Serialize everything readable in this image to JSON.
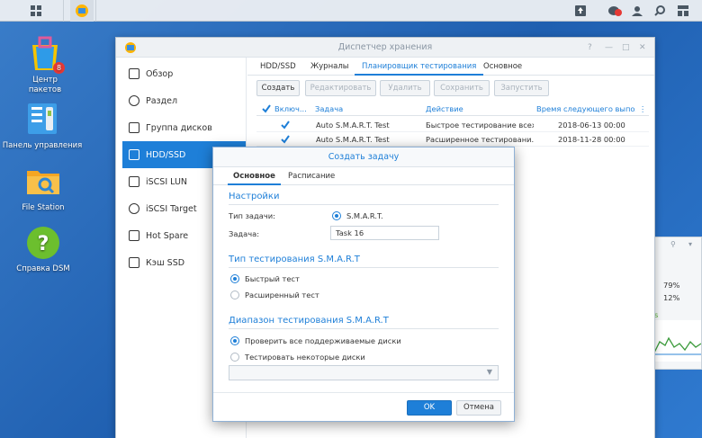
{
  "desktop": {
    "icons": [
      {
        "label_line1": "Центр",
        "label_line2": "пакетов",
        "badge": "8"
      },
      {
        "label": "Панель управления"
      },
      {
        "label": "File Station"
      },
      {
        "label": "Справка DSM"
      }
    ]
  },
  "widget": {
    "val1": "79%",
    "val2": "12%",
    "letter": "s"
  },
  "window": {
    "title": "Диспетчер хранения",
    "sidebar": [
      {
        "label": "Обзор"
      },
      {
        "label": "Раздел"
      },
      {
        "label": "Группа дисков"
      },
      {
        "label": "HDD/SSD"
      },
      {
        "label": "iSCSI LUN"
      },
      {
        "label": "iSCSI Target"
      },
      {
        "label": "Hot Spare"
      },
      {
        "label": "Кэш SSD"
      }
    ],
    "tabs": [
      "HDD/SSD",
      "Журналы",
      "Планировщик тестирования",
      "Основное"
    ],
    "toolbar": [
      "Создать",
      "Редактировать",
      "Удалить",
      "Сохранить",
      "Запустить"
    ],
    "columns": [
      "Включ...",
      "Задача",
      "Действие",
      "Время следующего выпол..."
    ],
    "rows": [
      {
        "task": "Auto S.M.A.R.T. Test",
        "action": "Быстрое тестирование всех...",
        "time": "2018-06-13 00:00"
      },
      {
        "task": "Auto S.M.A.R.T. Test",
        "action": "Расширенное тестировани...",
        "time": "2018-11-28 00:00"
      }
    ]
  },
  "dialog": {
    "title": "Создать задачу",
    "tabs": [
      "Основное",
      "Расписание"
    ],
    "section_settings": "Настройки",
    "task_type_label": "Тип задачи:",
    "task_type_value": "S.M.A.R.T.",
    "task_label": "Задача:",
    "task_value": "Task 16",
    "section_test_type": "Тип тестирования S.M.A.R.T",
    "quick_test": "Быстрый тест",
    "extended_test": "Расширенный тест",
    "section_range": "Диапазон тестирования S.M.A.R.T",
    "check_all": "Проверить все поддерживаемые диски",
    "test_some": "Тестировать некоторые диски",
    "ok": "OK",
    "cancel": "Отмена"
  },
  "colors": {
    "accent": "#1e7fd8",
    "desktop": "#2f6fc0"
  }
}
